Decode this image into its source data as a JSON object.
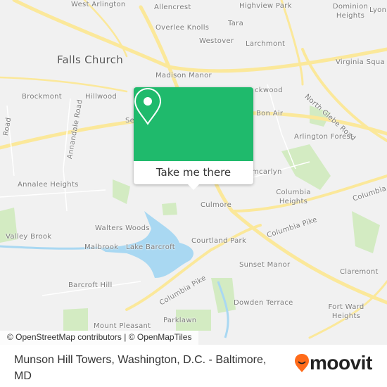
{
  "map": {
    "labels": {
      "west_arlington": "West Arlington",
      "allencrest": "Allencrest",
      "highview_park": "Highview Park",
      "dominion_heights": "Dominion Heights",
      "lyon": "Lyon",
      "tara": "Tara",
      "overlee_knolls": "Overlee Knolls",
      "westover": "Westover",
      "larchmont": "Larchmont",
      "falls_church": "Falls Church",
      "virginia_square": "Virginia Squa",
      "madison_manor": "Madison Manor",
      "north_glebe_road": "North Glebe Road",
      "brockmont": "Brockmont",
      "hillwood": "Hillwood",
      "lockwood": "ckwood",
      "bon_air": "Bon Air",
      "arlington_forest": "Arlington Forest",
      "annandale_road": "Annandale Road",
      "road_left": "Road",
      "seven_corners": "Se",
      "annalee_heights": "Annalee Heights",
      "glencarlyn": "mcarlyn",
      "columbia_heights": "Columbia Heights",
      "columbia_pike_1": "Columbia Pike",
      "culmore": "Culmore",
      "walters_woods": "Walters Woods",
      "columbia_pike_2": "Columbia Pike",
      "valley_brook": "Valley Brook",
      "courtland_park": "Courtland Park",
      "malbrook": "Malbrook",
      "lake_barcroft": "Lake Barcroft",
      "sunset_manor": "Sunset Manor",
      "claremont": "Claremont",
      "barcroft_hill": "Barcroft Hill",
      "columbia_pike_3": "Columbia Pike",
      "dowden_terrace": "Dowden Terrace",
      "fort_ward_heights": "Fort Ward Heights",
      "parklawn": "Parklawn",
      "mount_pleasant": "Mount Pleasant"
    },
    "attribution": "© OpenStreetMap contributors | © OpenMapTiles",
    "colors": {
      "road": "#fbe89a",
      "park": "#d3ebc2",
      "water": "#a9d8f2",
      "land": "#f1f1f1"
    }
  },
  "popup": {
    "icon": "map-pin-icon",
    "button_label": "Take me there",
    "color": "#1fba6c"
  },
  "footer": {
    "title": "Munson Hill Towers, Washington, D.C. - Baltimore, MD",
    "brand": "moovit",
    "brand_color": "#ff6b1a"
  }
}
